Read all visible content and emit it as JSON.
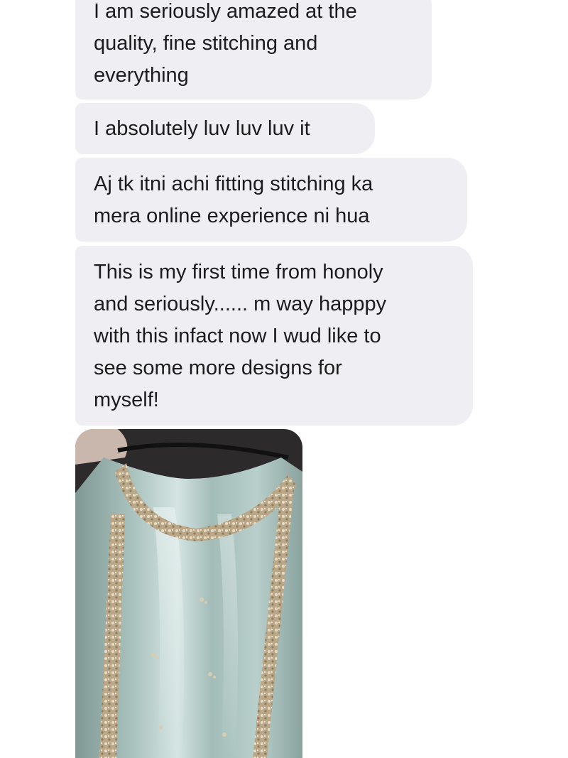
{
  "messages": [
    {
      "lines": [
        "I am seriously amazed at the",
        "quality, fine stitching and",
        "everything"
      ]
    },
    {
      "lines": [
        "I absolutely luv luv luv it"
      ]
    },
    {
      "lines": [
        "Aj tk itni achi fitting stitching ka",
        "mera online experience ni hua"
      ]
    },
    {
      "lines": [
        "This is my first time from honoly",
        "and seriously...... m way happpy",
        "with this infact now I wud like to",
        "see some more designs for",
        "myself!"
      ]
    }
  ],
  "photo": {
    "subject": "embroidered-mint-kurta-photo",
    "colors": {
      "fabric": "#9fb8b4",
      "fabric_highlight": "#d7e6e4",
      "embroidery": "#c8b89a",
      "background": "#2c2a2b",
      "skin": "#c9b7ad"
    }
  }
}
